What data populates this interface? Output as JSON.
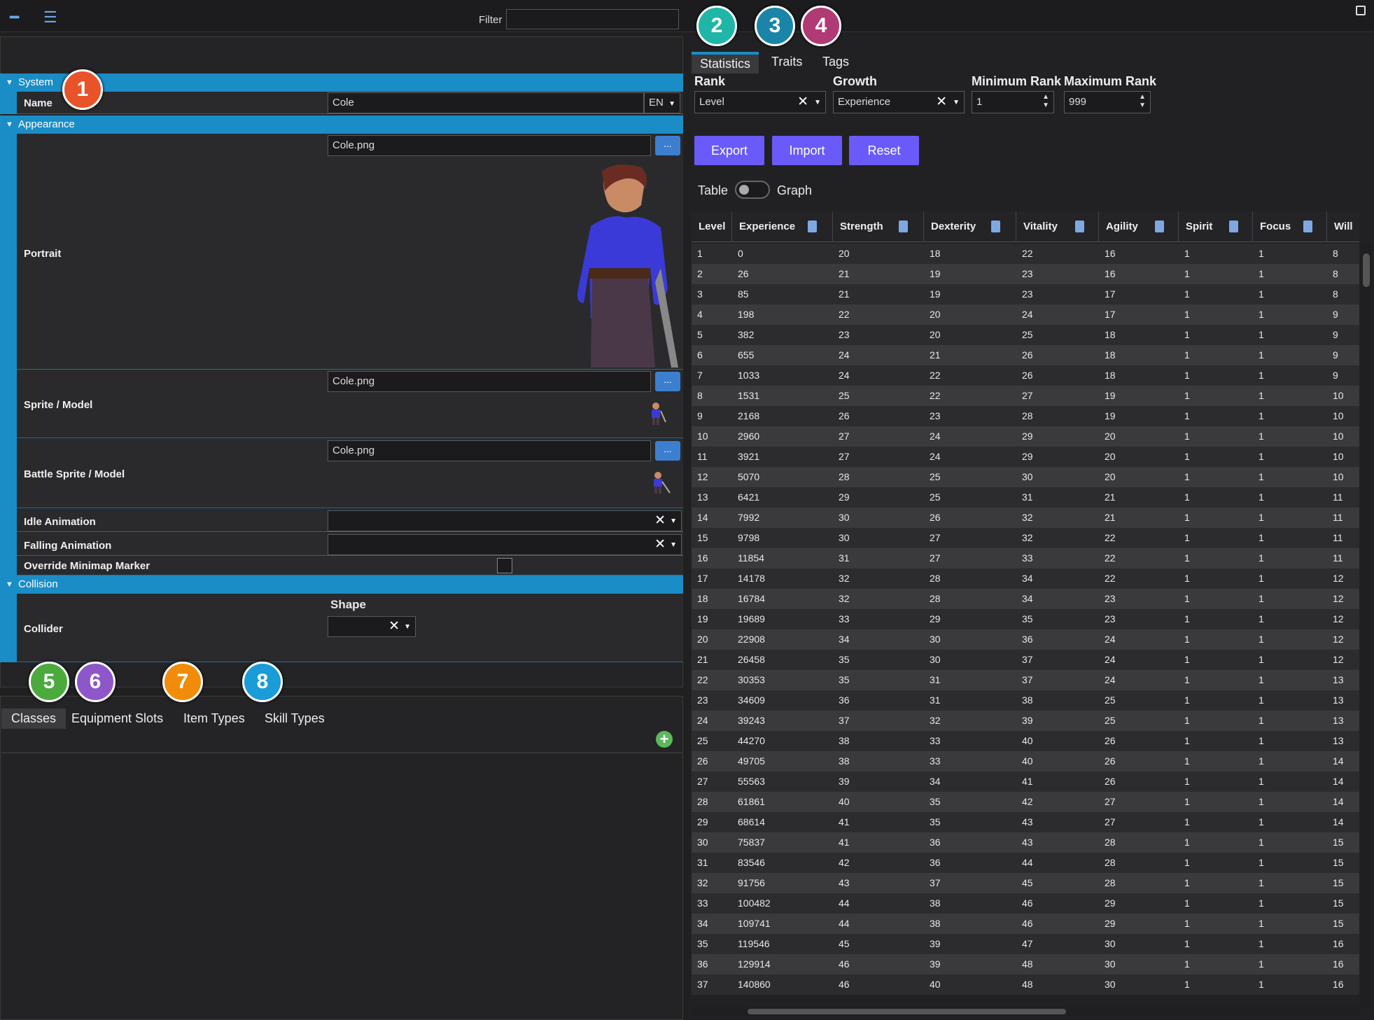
{
  "callouts": [
    "1",
    "2",
    "3",
    "4",
    "5",
    "6",
    "7",
    "8"
  ],
  "callout_colors": {
    "1": "#e8532a",
    "2": "#1fb6a8",
    "3": "#1a85a8",
    "4": "#b03a74",
    "5": "#4caa3c",
    "6": "#8e57c9",
    "7": "#f08c0a",
    "8": "#1a9cd8"
  },
  "left": {
    "filter_label": "Filter",
    "system": {
      "title": "System",
      "name_label": "Name",
      "name_value": "Cole",
      "lang": "EN"
    },
    "appearance": {
      "title": "Appearance",
      "portrait_label": "Portrait",
      "portrait_file": "Cole.png",
      "sprite_label": "Sprite / Model",
      "sprite_file": "Cole.png",
      "battle_label": "Battle Sprite / Model",
      "battle_file": "Cole.png",
      "idle_label": "Idle Animation",
      "falling_label": "Falling Animation",
      "minimap_label": "Override Minimap Marker",
      "browse": "..."
    },
    "collision": {
      "title": "Collision",
      "collider_label": "Collider",
      "shape_label": "Shape"
    }
  },
  "bottom_tabs": [
    "Classes",
    "Equipment Slots",
    "Item Types",
    "Skill Types"
  ],
  "right": {
    "tabs": [
      "Statistics",
      "Traits",
      "Tags"
    ],
    "rank_label": "Rank",
    "rank_value": "Level",
    "growth_label": "Growth",
    "growth_value": "Experience",
    "min_rank_label": "Minimum Rank",
    "min_rank_value": "1",
    "max_rank_label": "Maximum Rank",
    "max_rank_value": "999",
    "buttons": [
      "Export",
      "Import",
      "Reset"
    ],
    "table_label": "Table",
    "graph_label": "Graph"
  },
  "table": {
    "columns": [
      "Level",
      "Experience",
      "Strength",
      "Dexterity",
      "Vitality",
      "Agility",
      "Spirit",
      "Focus",
      "Will"
    ],
    "rows": [
      [
        "1",
        "0",
        "20",
        "18",
        "22",
        "16",
        "1",
        "1",
        "8"
      ],
      [
        "2",
        "26",
        "21",
        "19",
        "23",
        "16",
        "1",
        "1",
        "8"
      ],
      [
        "3",
        "85",
        "21",
        "19",
        "23",
        "17",
        "1",
        "1",
        "8"
      ],
      [
        "4",
        "198",
        "22",
        "20",
        "24",
        "17",
        "1",
        "1",
        "9"
      ],
      [
        "5",
        "382",
        "23",
        "20",
        "25",
        "18",
        "1",
        "1",
        "9"
      ],
      [
        "6",
        "655",
        "24",
        "21",
        "26",
        "18",
        "1",
        "1",
        "9"
      ],
      [
        "7",
        "1033",
        "24",
        "22",
        "26",
        "18",
        "1",
        "1",
        "9"
      ],
      [
        "8",
        "1531",
        "25",
        "22",
        "27",
        "19",
        "1",
        "1",
        "10"
      ],
      [
        "9",
        "2168",
        "26",
        "23",
        "28",
        "19",
        "1",
        "1",
        "10"
      ],
      [
        "10",
        "2960",
        "27",
        "24",
        "29",
        "20",
        "1",
        "1",
        "10"
      ],
      [
        "11",
        "3921",
        "27",
        "24",
        "29",
        "20",
        "1",
        "1",
        "10"
      ],
      [
        "12",
        "5070",
        "28",
        "25",
        "30",
        "20",
        "1",
        "1",
        "10"
      ],
      [
        "13",
        "6421",
        "29",
        "25",
        "31",
        "21",
        "1",
        "1",
        "11"
      ],
      [
        "14",
        "7992",
        "30",
        "26",
        "32",
        "21",
        "1",
        "1",
        "11"
      ],
      [
        "15",
        "9798",
        "30",
        "27",
        "32",
        "22",
        "1",
        "1",
        "11"
      ],
      [
        "16",
        "11854",
        "31",
        "27",
        "33",
        "22",
        "1",
        "1",
        "11"
      ],
      [
        "17",
        "14178",
        "32",
        "28",
        "34",
        "22",
        "1",
        "1",
        "12"
      ],
      [
        "18",
        "16784",
        "32",
        "28",
        "34",
        "23",
        "1",
        "1",
        "12"
      ],
      [
        "19",
        "19689",
        "33",
        "29",
        "35",
        "23",
        "1",
        "1",
        "12"
      ],
      [
        "20",
        "22908",
        "34",
        "30",
        "36",
        "24",
        "1",
        "1",
        "12"
      ],
      [
        "21",
        "26458",
        "35",
        "30",
        "37",
        "24",
        "1",
        "1",
        "12"
      ],
      [
        "22",
        "30353",
        "35",
        "31",
        "37",
        "24",
        "1",
        "1",
        "13"
      ],
      [
        "23",
        "34609",
        "36",
        "31",
        "38",
        "25",
        "1",
        "1",
        "13"
      ],
      [
        "24",
        "39243",
        "37",
        "32",
        "39",
        "25",
        "1",
        "1",
        "13"
      ],
      [
        "25",
        "44270",
        "38",
        "33",
        "40",
        "26",
        "1",
        "1",
        "13"
      ],
      [
        "26",
        "49705",
        "38",
        "33",
        "40",
        "26",
        "1",
        "1",
        "14"
      ],
      [
        "27",
        "55563",
        "39",
        "34",
        "41",
        "26",
        "1",
        "1",
        "14"
      ],
      [
        "28",
        "61861",
        "40",
        "35",
        "42",
        "27",
        "1",
        "1",
        "14"
      ],
      [
        "29",
        "68614",
        "41",
        "35",
        "43",
        "27",
        "1",
        "1",
        "14"
      ],
      [
        "30",
        "75837",
        "41",
        "36",
        "43",
        "28",
        "1",
        "1",
        "15"
      ],
      [
        "31",
        "83546",
        "42",
        "36",
        "44",
        "28",
        "1",
        "1",
        "15"
      ],
      [
        "32",
        "91756",
        "43",
        "37",
        "45",
        "28",
        "1",
        "1",
        "15"
      ],
      [
        "33",
        "100482",
        "44",
        "38",
        "46",
        "29",
        "1",
        "1",
        "15"
      ],
      [
        "34",
        "109741",
        "44",
        "38",
        "46",
        "29",
        "1",
        "1",
        "15"
      ],
      [
        "35",
        "119546",
        "45",
        "39",
        "47",
        "30",
        "1",
        "1",
        "16"
      ],
      [
        "36",
        "129914",
        "46",
        "39",
        "48",
        "30",
        "1",
        "1",
        "16"
      ],
      [
        "37",
        "140860",
        "46",
        "40",
        "48",
        "30",
        "1",
        "1",
        "16"
      ]
    ]
  }
}
